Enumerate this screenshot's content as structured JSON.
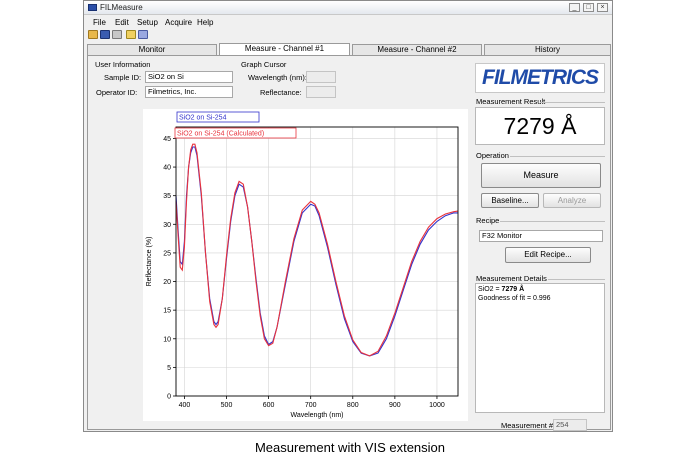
{
  "window": {
    "title": "FILMeasure",
    "min": "_",
    "max": "□",
    "close": "×"
  },
  "menu": [
    "File",
    "Edit",
    "Setup",
    "Acquire",
    "Help"
  ],
  "tabs": [
    {
      "label": "Monitor",
      "active": false
    },
    {
      "label": "Measure - Channel #1",
      "active": true
    },
    {
      "label": "Measure - Channel #2",
      "active": false
    },
    {
      "label": "History",
      "active": false
    }
  ],
  "user_info": {
    "heading": "User Information",
    "sample_label": "Sample ID:",
    "sample_value": "SiO2 on Si",
    "operator_label": "Operator ID:",
    "operator_value": "Filmetrics, Inc."
  },
  "graph_cursor": {
    "heading": "Graph Cursor",
    "wavelength_label": "Wavelength (nm):",
    "wavelength_value": "",
    "reflectance_label": "Reflectance:",
    "reflectance_value": ""
  },
  "logo": "FILMETRICS",
  "measurement_result": {
    "heading": "Measurement Result",
    "value": "7279 Å"
  },
  "operation": {
    "heading": "Operation",
    "measure_label": "Measure",
    "baseline_label": "Baseline...",
    "analyze_label": "Analyze"
  },
  "recipe": {
    "heading": "Recipe",
    "value": "F32 Monitor",
    "edit_label": "Edit Recipe..."
  },
  "details": {
    "heading": "Measurement Details",
    "line1_label": "SiO2 = ",
    "line1_value": "7279 Å",
    "line2": "Goodness of fit = 0.996"
  },
  "measurement_number": {
    "label": "Measurement #",
    "value": "254"
  },
  "caption": "Measurement with VIS extension",
  "colors": {
    "measured": "#3333cc",
    "calculated": "#e8323c",
    "logo": "#1f4ba8"
  },
  "chart_data": {
    "type": "line",
    "xlabel": "Wavelength (nm)",
    "ylabel": "Reflectance (%)",
    "xlim": [
      380,
      1050
    ],
    "ylim": [
      0,
      47
    ],
    "xticks": [
      400,
      500,
      600,
      700,
      800,
      900,
      1000
    ],
    "yticks": [
      0,
      5,
      10,
      15,
      20,
      25,
      30,
      35,
      40,
      45
    ],
    "grid": true,
    "legend": "top-left",
    "series": [
      {
        "name": "SiO2 on Si-254",
        "color": "#3333cc",
        "points": [
          [
            380,
            35
          ],
          [
            385,
            29
          ],
          [
            390,
            23.5
          ],
          [
            395,
            23
          ],
          [
            400,
            27
          ],
          [
            405,
            35
          ],
          [
            410,
            40
          ],
          [
            415,
            42.5
          ],
          [
            420,
            43.5
          ],
          [
            425,
            43.5
          ],
          [
            430,
            42
          ],
          [
            440,
            35
          ],
          [
            450,
            25
          ],
          [
            460,
            17
          ],
          [
            470,
            13
          ],
          [
            475,
            12.5
          ],
          [
            480,
            13
          ],
          [
            490,
            17
          ],
          [
            500,
            24
          ],
          [
            510,
            30.5
          ],
          [
            520,
            35
          ],
          [
            530,
            37
          ],
          [
            540,
            36.5
          ],
          [
            550,
            33
          ],
          [
            560,
            27
          ],
          [
            570,
            20.5
          ],
          [
            580,
            14.5
          ],
          [
            590,
            10.5
          ],
          [
            600,
            9
          ],
          [
            610,
            9.5
          ],
          [
            620,
            12
          ],
          [
            640,
            19.5
          ],
          [
            660,
            27
          ],
          [
            680,
            32
          ],
          [
            700,
            33.5
          ],
          [
            710,
            33.2
          ],
          [
            720,
            31.5
          ],
          [
            740,
            26
          ],
          [
            760,
            19.5
          ],
          [
            780,
            13.5
          ],
          [
            800,
            9.5
          ],
          [
            820,
            7.5
          ],
          [
            840,
            7
          ],
          [
            860,
            7.5
          ],
          [
            880,
            10
          ],
          [
            900,
            14
          ],
          [
            920,
            18.5
          ],
          [
            940,
            23
          ],
          [
            960,
            26.5
          ],
          [
            980,
            29
          ],
          [
            1000,
            30.5
          ],
          [
            1020,
            31.5
          ],
          [
            1040,
            32
          ],
          [
            1050,
            32
          ]
        ]
      },
      {
        "name": "SiO2 on Si-254 (Calculated)",
        "color": "#e8323c",
        "points": [
          [
            380,
            34
          ],
          [
            385,
            28
          ],
          [
            390,
            22.5
          ],
          [
            395,
            22
          ],
          [
            400,
            26
          ],
          [
            405,
            34
          ],
          [
            410,
            40
          ],
          [
            415,
            43
          ],
          [
            420,
            44
          ],
          [
            425,
            44
          ],
          [
            430,
            42.5
          ],
          [
            440,
            35.5
          ],
          [
            450,
            25
          ],
          [
            460,
            16.5
          ],
          [
            470,
            12.5
          ],
          [
            475,
            12
          ],
          [
            480,
            12.5
          ],
          [
            490,
            17
          ],
          [
            500,
            24.5
          ],
          [
            510,
            31
          ],
          [
            520,
            35.5
          ],
          [
            530,
            37.5
          ],
          [
            540,
            37
          ],
          [
            550,
            33
          ],
          [
            560,
            27
          ],
          [
            570,
            20
          ],
          [
            580,
            14
          ],
          [
            590,
            10
          ],
          [
            600,
            8.8
          ],
          [
            610,
            9.2
          ],
          [
            620,
            12
          ],
          [
            640,
            20
          ],
          [
            660,
            27.5
          ],
          [
            680,
            32.5
          ],
          [
            700,
            34
          ],
          [
            710,
            33.5
          ],
          [
            720,
            32
          ],
          [
            740,
            26.5
          ],
          [
            760,
            20
          ],
          [
            780,
            14
          ],
          [
            800,
            9.8
          ],
          [
            820,
            7.6
          ],
          [
            840,
            7
          ],
          [
            860,
            7.8
          ],
          [
            880,
            10.5
          ],
          [
            900,
            14.5
          ],
          [
            920,
            19
          ],
          [
            940,
            23.5
          ],
          [
            960,
            27
          ],
          [
            980,
            29.5
          ],
          [
            1000,
            31
          ],
          [
            1020,
            31.8
          ],
          [
            1040,
            32.2
          ],
          [
            1050,
            32.3
          ]
        ]
      }
    ]
  }
}
